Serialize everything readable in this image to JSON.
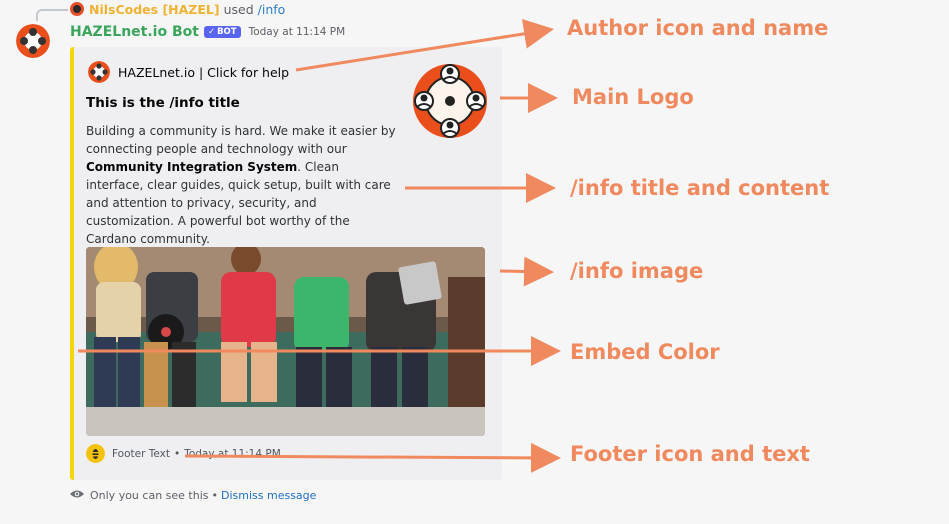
{
  "reply": {
    "username": "NilsCodes [HAZEL]",
    "used": "used",
    "command": "/info"
  },
  "message": {
    "username": "HAZELnet.io Bot",
    "bot_tag": "BOT",
    "bot_check": "✓",
    "timestamp": "Today at 11:14 PM"
  },
  "embed": {
    "color": "#f5d60b",
    "author": "HAZELnet.io | Click for help",
    "title": "This is the /info title",
    "description_before": "Building a community is hard. We make it easier by connecting people and technology with our ",
    "description_bold": "Community Integration System",
    "description_after": ". Clean interface, clear guides, quick setup, built with care and attention to privacy, security, and customization. A powerful bot worthy of the Cardano community.",
    "footer_text": "Footer Text",
    "footer_sep": "•",
    "footer_time": "Today at 11:14 PM"
  },
  "ephemeral": {
    "text": "Only you can see this",
    "sep": "•",
    "dismiss": "Dismiss message"
  },
  "annotations": {
    "author": "Author icon and name",
    "logo": "Main Logo",
    "content": "/info title and content",
    "image": "/info image",
    "color": "Embed Color",
    "footer": "Footer icon and text"
  },
  "icons": {
    "logo": "people-network-icon",
    "footer": "bee-icon",
    "eye": "eye-icon"
  },
  "colors": {
    "accent": "#f0895e",
    "embed": "#f5d60b",
    "username": "#3ba55c",
    "bot_tag": "#5865f2"
  }
}
